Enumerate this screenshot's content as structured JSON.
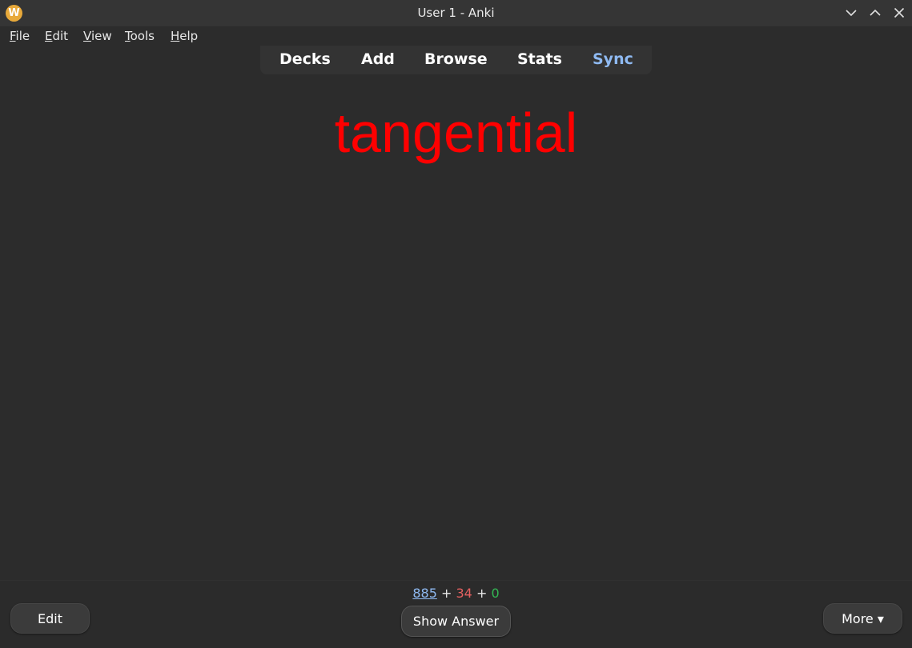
{
  "window": {
    "title": "User 1 - Anki",
    "app_icon_letter": "W",
    "controls": [
      "minimize-icon",
      "maximize-icon",
      "close-icon"
    ]
  },
  "menu": {
    "items": [
      {
        "mnemonic": "F",
        "rest": "ile"
      },
      {
        "mnemonic": "E",
        "rest": "dit"
      },
      {
        "mnemonic": "V",
        "rest": "iew"
      },
      {
        "mnemonic": "T",
        "rest": "ools"
      },
      {
        "mnemonic": "H",
        "rest": "elp"
      }
    ]
  },
  "toolbar": {
    "decks": "Decks",
    "add": "Add",
    "browse": "Browse",
    "stats": "Stats",
    "sync": "Sync"
  },
  "card": {
    "front": "tangential",
    "front_color": "#ff0000"
  },
  "bottom": {
    "counts": {
      "new": "885",
      "sep1": " + ",
      "learn": "34",
      "sep2": " + ",
      "review": "0"
    },
    "edit_label": "Edit",
    "show_answer_label": "Show Answer",
    "more_label": "More ▾"
  },
  "colors": {
    "background": "#2c2c2c",
    "accent_blue": "#8fbaf2",
    "learn_red": "#e46060",
    "review_green": "#33b653"
  }
}
